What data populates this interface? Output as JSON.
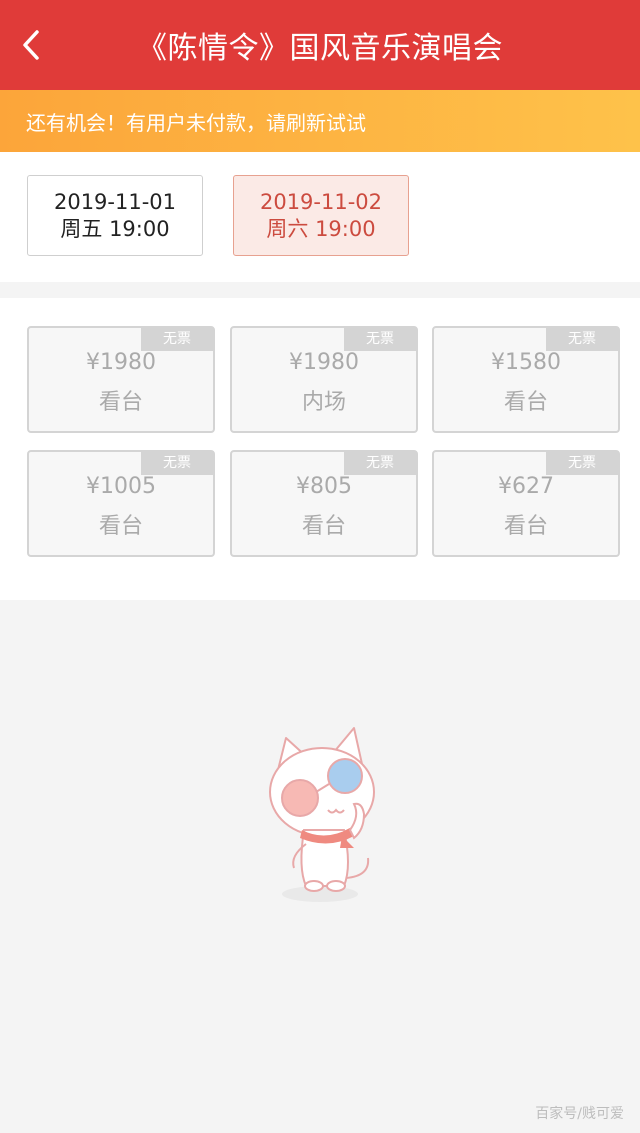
{
  "header": {
    "title": "《陈情令》国风音乐演唱会",
    "back_icon": "chevron-left-icon"
  },
  "notice": {
    "text": "还有机会！有用户未付款，请刷新试试"
  },
  "dates": [
    {
      "date": "2019-11-01",
      "time": "周五 19:00",
      "selected": false
    },
    {
      "date": "2019-11-02",
      "time": "周六 19:00",
      "selected": true
    }
  ],
  "tickets": [
    {
      "price": "¥1980",
      "area": "看台",
      "badge": "无票"
    },
    {
      "price": "¥1980",
      "area": "内场",
      "badge": "无票"
    },
    {
      "price": "¥1580",
      "area": "看台",
      "badge": "无票"
    },
    {
      "price": "¥1005",
      "area": "看台",
      "badge": "无票"
    },
    {
      "price": "¥805",
      "area": "看台",
      "badge": "无票"
    },
    {
      "price": "¥627",
      "area": "看台",
      "badge": "无票"
    }
  ],
  "illustration": {
    "icon": "cat-mascot-icon"
  },
  "watermark": {
    "text": "百家号/贱可爱"
  },
  "colors": {
    "header": "#e03b39",
    "notice_start": "#fca53a",
    "notice_end": "#fec24a",
    "selected_text": "#cc4b3f"
  }
}
